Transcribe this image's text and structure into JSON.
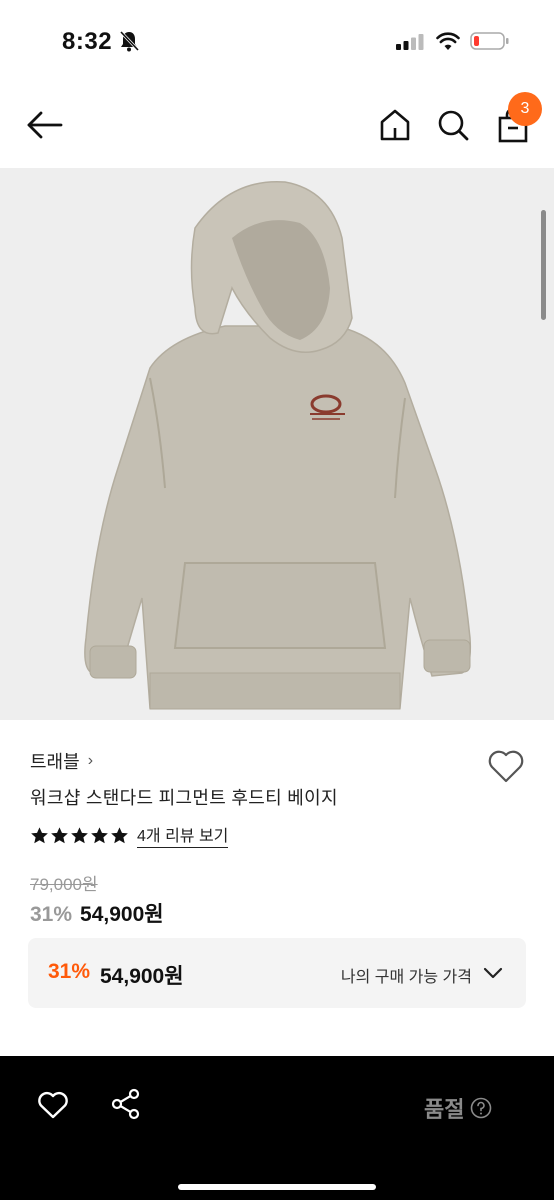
{
  "status_bar": {
    "time": "8:32"
  },
  "header": {
    "cart_count": "3"
  },
  "product": {
    "brand": "트래블",
    "brand_chevron": "›",
    "title": "워크샵 스탠다드 피그먼트 후드티 베이지",
    "rating_stars": 5,
    "review_link": "4개 리뷰 보기",
    "original_price": "79,000원",
    "discount_rate": "31%",
    "sale_price": "54,900원"
  },
  "my_price": {
    "rate": "31%",
    "price": "54,900원",
    "label": "나의 구매 가능 가격"
  },
  "bottom_bar": {
    "status": "품절"
  },
  "colors": {
    "accent": "#ff5a0a",
    "badge": "#ff6a1a",
    "hoodie": "#c4bfb3",
    "image_bg": "#eeeeee"
  },
  "icons": [
    "bell-slash-icon",
    "signal-icon",
    "wifi-icon",
    "battery-icon",
    "back-arrow-icon",
    "home-icon",
    "search-icon",
    "shopping-bag-icon",
    "heart-icon",
    "star-icon",
    "chevron-down-icon",
    "share-icon",
    "question-icon"
  ]
}
